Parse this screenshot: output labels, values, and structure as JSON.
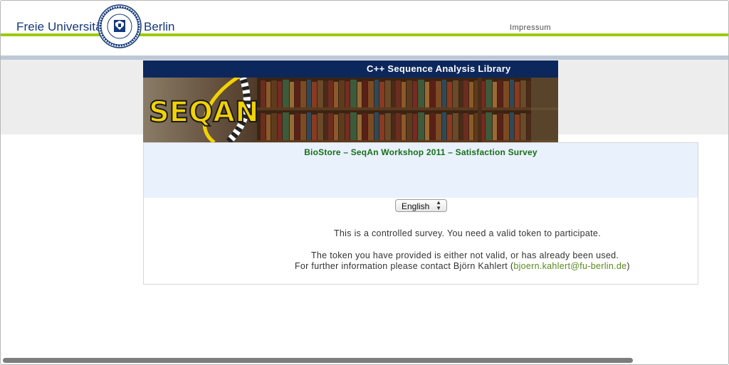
{
  "header": {
    "university_left": "Freie Universität",
    "university_right": "Berlin",
    "impressum_link": "Impressum"
  },
  "banner": {
    "title": "C++ Sequence Analysis Library",
    "logo_text": "SEQAN"
  },
  "survey": {
    "title": "BioStore – SeqAn Workshop 2011 – Satisfaction Survey",
    "language_selected": "English",
    "message_controlled": "This is a controlled survey. You need a valid token to participate.",
    "message_invalid": "The token you have provided is either not valid, or has already been used.",
    "contact_prefix": "For further information please contact Björn Kahlert (",
    "contact_email": "bjoern.kahlert@fu-berlin.de",
    "contact_suffix": ")"
  },
  "colors": {
    "fu_blue": "#14387a",
    "fu_green": "#99cc00",
    "banner_navy": "#0c275c",
    "survey_title_green": "#176f17",
    "link_green": "#5a8a1f"
  }
}
